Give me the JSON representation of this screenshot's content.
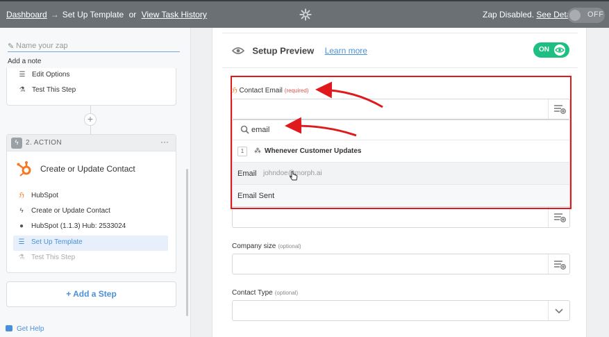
{
  "topbar": {
    "dashboard": "Dashboard",
    "arrow": "→",
    "current": "Set Up Template",
    "or": "or",
    "history": "View Task History",
    "status_text": "Zap Disabled.",
    "see_details": "See Details",
    "toggle_label": "OFF"
  },
  "sidebar": {
    "zap_name_placeholder": "Name your zap",
    "add_note": "Add a note",
    "trigger_rows": [
      "Edit Options",
      "Test This Step"
    ],
    "action_header": "2. ACTION",
    "action_title": "Create or Update Contact",
    "action_rows": [
      "HubSpot",
      "Create or Update Contact",
      "HubSpot (1.1.3) Hub: 2533024",
      "Set Up Template",
      "Test This Step"
    ],
    "add_step": "+ Add a Step",
    "get_help": "Get Help",
    "more": "···"
  },
  "main": {
    "preview_title": "Setup Preview",
    "learn_more": "Learn more",
    "toggle_label": "ON",
    "field1_label": "Contact Email",
    "field1_req": "(required)",
    "search_value": "email",
    "group_number": "1",
    "group_label": "Whenever Customer Updates",
    "option1_key": "Email",
    "option1_value": "johndoe@morph.ai",
    "option2_key": "Email Sent",
    "field2_label": "Company size",
    "field2_opt": "(optional)",
    "field3_label": "Contact Type",
    "field3_opt": "(optional)"
  },
  "colors": {
    "topbar": "#6b7075",
    "accent_blue": "#4a90d9",
    "on_green": "#1fbf83",
    "hubspot_orange": "#f57722",
    "annotation_red": "#e0191c"
  },
  "icons": [
    "gear-icon",
    "pencil-icon",
    "list-icon",
    "flask-icon",
    "bolt-icon",
    "hubspot-icon",
    "user-icon",
    "eye-icon",
    "search-icon",
    "list-plus-icon",
    "chevron-down-icon",
    "help-icon"
  ]
}
